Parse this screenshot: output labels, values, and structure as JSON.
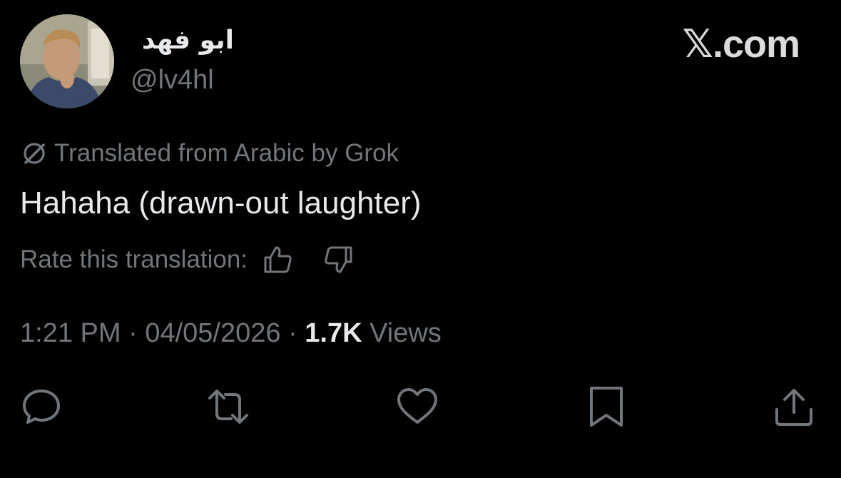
{
  "tweet": {
    "author": {
      "display_name": "ابو فهد",
      "handle": "@lv4hl"
    },
    "watermark": "𝕏.com",
    "translation_notice": "Translated from Arabic by Grok",
    "text": "Hahaha (drawn-out laughter)",
    "rate_label": "Rate this translation:",
    "meta": {
      "time": "1:21 PM",
      "separator": "·",
      "date": "04/05/2026",
      "views_count": "1.7K",
      "views_label": "Views"
    },
    "icons": {
      "grok": "grok-icon",
      "thumbs_up": "thumbs-up-icon",
      "thumbs_down": "thumbs-down-icon",
      "reply": "reply-icon",
      "repost": "repost-icon",
      "like": "like-icon",
      "bookmark": "bookmark-icon",
      "share": "share-icon"
    }
  },
  "colors": {
    "background": "#000000",
    "primary_text": "#e7e9ea",
    "secondary_text": "#71767b"
  }
}
